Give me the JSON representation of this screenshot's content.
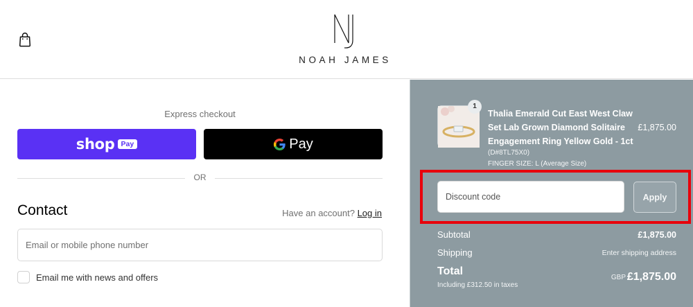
{
  "header": {
    "brand_name": "NOAH JAMES",
    "cart_icon": "shopping-bag-icon",
    "logo_icon": "nj-monogram-icon"
  },
  "express": {
    "label": "Express checkout",
    "shop_pay_word": "shop",
    "shop_pay_badge": "Pay",
    "google_pay_word": "Pay",
    "or_label": "OR",
    "shop_pay_color": "#5a31f4"
  },
  "contact": {
    "heading": "Contact",
    "account_prompt": "Have an account?",
    "login_label": "Log in",
    "email_placeholder": "Email or mobile phone number",
    "news_label": "Email me with news and offers"
  },
  "order": {
    "quantity": "1",
    "product_title": "Thalia Emerald Cut East West Claw Set Lab Grown Diamond Solitaire Engagement Ring Yellow Gold - 1ct",
    "product_sku": "(D#8TL75X0)",
    "product_variant": "FINGER SIZE: L (Average Size)",
    "product_price": "£1,875.00",
    "discount_placeholder": "Discount code",
    "apply_label": "Apply",
    "subtotal_label": "Subtotal",
    "subtotal_value": "£1,875.00",
    "shipping_label": "Shipping",
    "shipping_value": "Enter shipping address",
    "total_label": "Total",
    "tax_note": "Including £312.50 in taxes",
    "currency": "GBP",
    "total_value": "£1,875.00",
    "highlight_color": "#e8000b"
  }
}
